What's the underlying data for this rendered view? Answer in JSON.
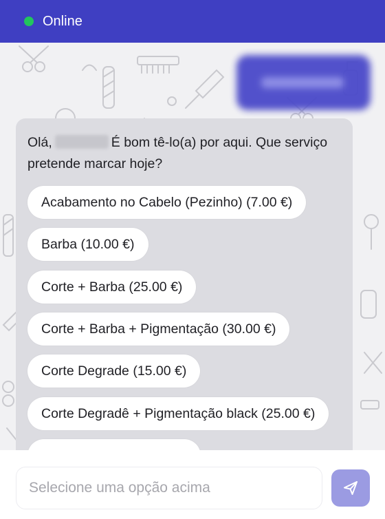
{
  "header": {
    "status_text": "Online",
    "status_color": "#22c55e",
    "background_color": "#3f3fc2"
  },
  "chat": {
    "outgoing_message": "",
    "bot_message": {
      "greeting_prefix": "Olá,",
      "greeting_suffix": "É bom tê-lo(a) por aqui. Que serviço pretende marcar hoje?"
    },
    "options": [
      "Acabamento no Cabelo (Pezinho) (7.00 €)",
      "Barba (10.00 €)",
      "Corte + Barba (25.00 €)",
      "Corte + Barba + Pigmentação (30.00 €)",
      "Corte Degrade (15.00 €)",
      "Corte Degradê + Pigmentação black (25.00 €)",
      ""
    ]
  },
  "composer": {
    "placeholder": "Selecione uma opção acima",
    "send_icon": "send-icon",
    "send_button_color": "#9b9be2"
  }
}
